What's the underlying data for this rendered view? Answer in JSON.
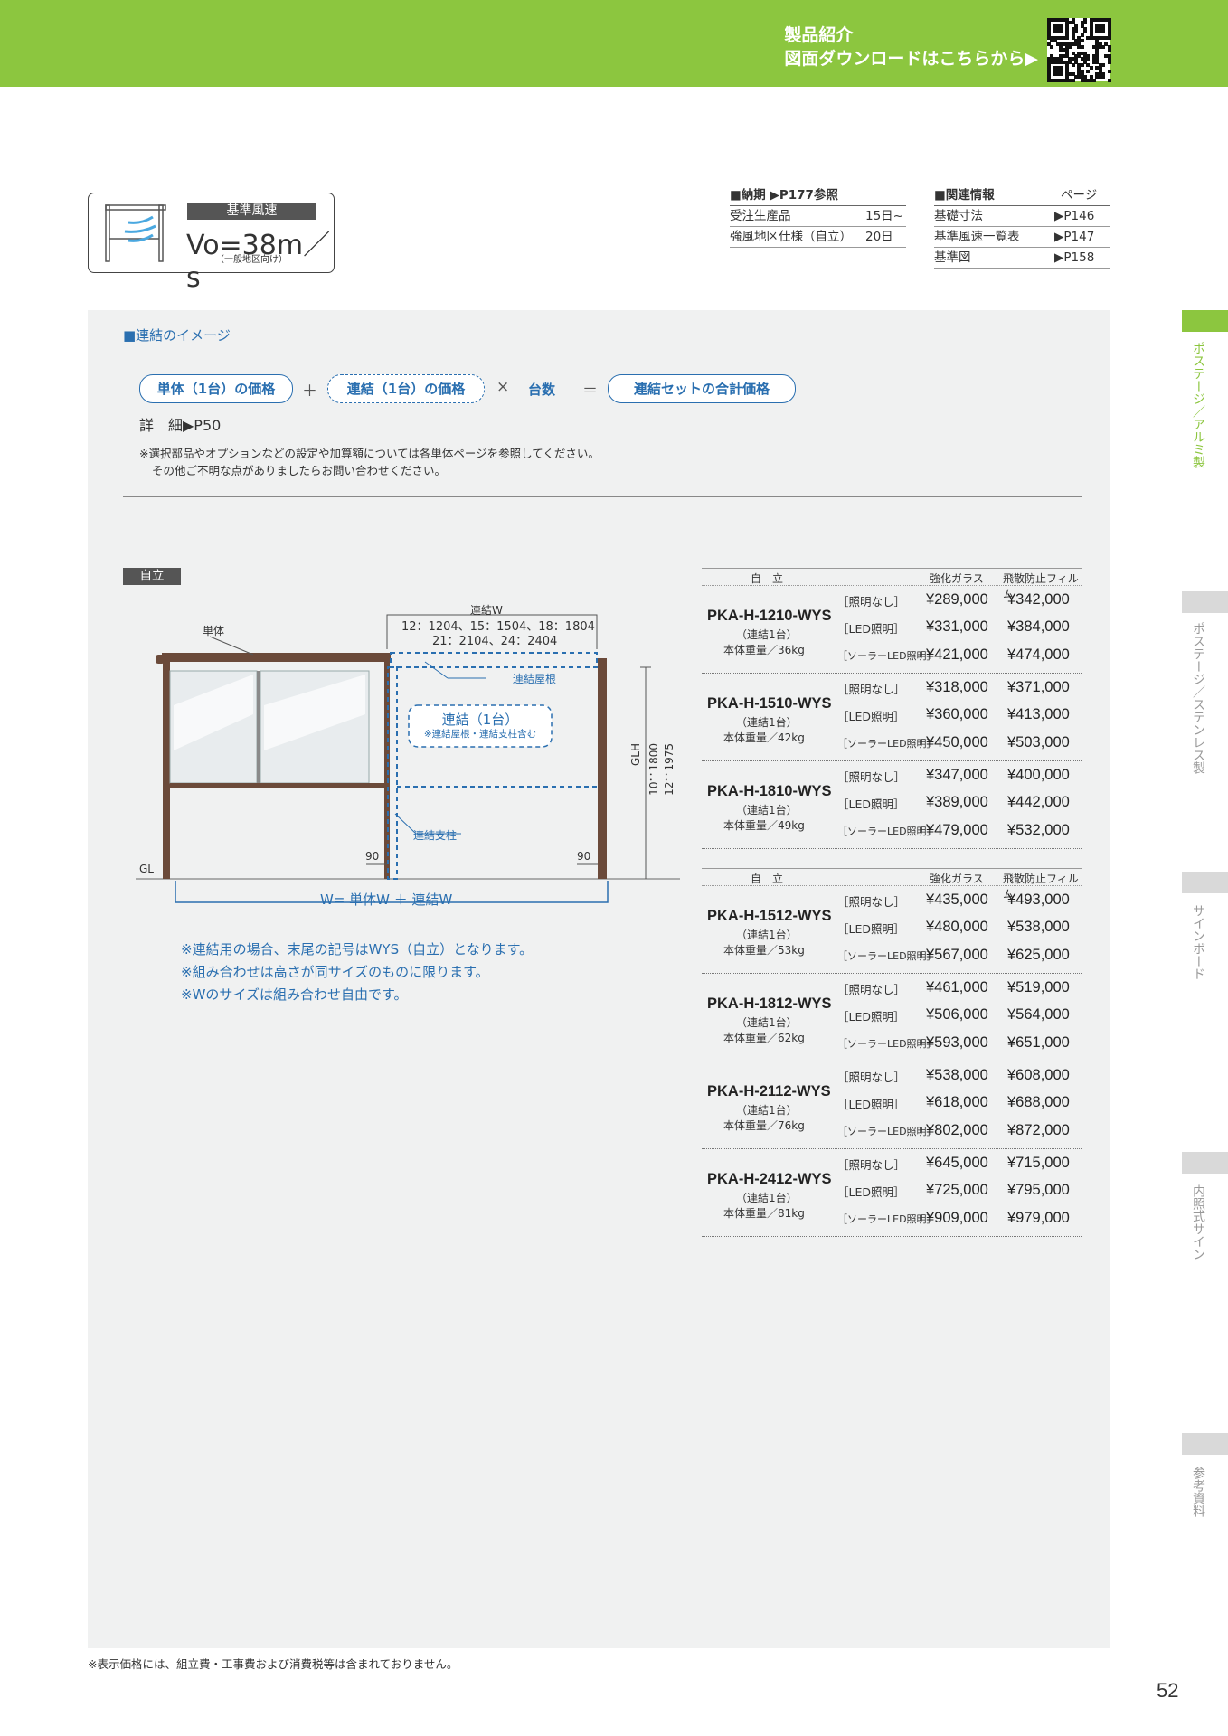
{
  "header": {
    "line1": "製品紹介",
    "line2": "図面ダウンロードはこちらから▶",
    "accent_color": "#8cc63f"
  },
  "wind": {
    "title": "基準風速",
    "value": "Vo=38m／s",
    "note": "（一般地区向け）"
  },
  "delivery": {
    "head": "■納期 ▶P177参照",
    "rows": [
      {
        "label": "受注生産品",
        "value": "15日~"
      },
      {
        "label": "強風地区仕様（自立）",
        "value": "20日"
      }
    ]
  },
  "related": {
    "head": "■関連情報",
    "page_head": "ページ",
    "rows": [
      {
        "label": "基礎寸法",
        "value": "▶P146"
      },
      {
        "label": "基準風速一覧表",
        "value": "▶P147"
      },
      {
        "label": "基準図",
        "value": "▶P158"
      }
    ]
  },
  "image_section": {
    "title": "■連結のイメージ",
    "formula": {
      "single": "単体（1台）の価格",
      "plus": "＋",
      "link": "連結（1台）の価格",
      "times": "×",
      "count": "台数",
      "equals": "＝",
      "total": "連結セットの合計価格"
    },
    "detail": "詳　細▶P50",
    "notes": [
      "※選択部品やオプションなどの設定や加算額については各単体ページを参照してください。",
      "その他ご不明な点がありましたらお問い合わせください。"
    ]
  },
  "diagram": {
    "tag": "自立",
    "w_title": "連結W",
    "w_line1": "12：1204、15：1504、18：1804",
    "w_line2": "21：2104、24：2404",
    "single_label": "単体",
    "roof_label": "連結屋根",
    "link_title": "連結（1台）",
    "link_note": "※連結屋根・連結支柱含む",
    "post_label": "連結支柱",
    "glh": "GLH",
    "glh_10": "10：1800",
    "glh_12": "12：1975",
    "gl": "GL",
    "dim_90_left": "90",
    "dim_90_right": "90",
    "w_formula": "W= 単体W ＋ 連結W",
    "frame_color": "#6b4a3a",
    "dash_color": "#2a6fb0"
  },
  "diagram_notes": [
    "※連結用の場合、末尾の記号はWYS（自立）となります。",
    "※組み合わせは高さが同サイズのものに限ります。",
    "※Wのサイズは組み合わせ自由です。"
  ],
  "price_tables": [
    {
      "head": {
        "type": "自　立",
        "col1": "強化ガラス",
        "col2": "飛散防止フィルム"
      },
      "products": [
        {
          "name": "PKA-H-1210-WYS",
          "sub": "（連結1台）",
          "weight": "本体重量／36kg",
          "rows": [
            {
              "label": "［照明なし］",
              "v1": "¥289,000",
              "v2": "¥342,000"
            },
            {
              "label": "［LED照明］",
              "v1": "¥331,000",
              "v2": "¥384,000"
            },
            {
              "label": "［ソーラーLED照明］",
              "v1": "¥421,000",
              "v2": "¥474,000"
            }
          ]
        },
        {
          "name": "PKA-H-1510-WYS",
          "sub": "（連結1台）",
          "weight": "本体重量／42kg",
          "rows": [
            {
              "label": "［照明なし］",
              "v1": "¥318,000",
              "v2": "¥371,000"
            },
            {
              "label": "［LED照明］",
              "v1": "¥360,000",
              "v2": "¥413,000"
            },
            {
              "label": "［ソーラーLED照明］",
              "v1": "¥450,000",
              "v2": "¥503,000"
            }
          ]
        },
        {
          "name": "PKA-H-1810-WYS",
          "sub": "（連結1台）",
          "weight": "本体重量／49kg",
          "rows": [
            {
              "label": "［照明なし］",
              "v1": "¥347,000",
              "v2": "¥400,000"
            },
            {
              "label": "［LED照明］",
              "v1": "¥389,000",
              "v2": "¥442,000"
            },
            {
              "label": "［ソーラーLED照明］",
              "v1": "¥479,000",
              "v2": "¥532,000"
            }
          ]
        }
      ]
    },
    {
      "head": {
        "type": "自　立",
        "col1": "強化ガラス",
        "col2": "飛散防止フィルム"
      },
      "products": [
        {
          "name": "PKA-H-1512-WYS",
          "sub": "（連結1台）",
          "weight": "本体重量／53kg",
          "rows": [
            {
              "label": "［照明なし］",
              "v1": "¥435,000",
              "v2": "¥493,000"
            },
            {
              "label": "［LED照明］",
              "v1": "¥480,000",
              "v2": "¥538,000"
            },
            {
              "label": "［ソーラーLED照明］",
              "v1": "¥567,000",
              "v2": "¥625,000"
            }
          ]
        },
        {
          "name": "PKA-H-1812-WYS",
          "sub": "（連結1台）",
          "weight": "本体重量／62kg",
          "rows": [
            {
              "label": "［照明なし］",
              "v1": "¥461,000",
              "v2": "¥519,000"
            },
            {
              "label": "［LED照明］",
              "v1": "¥506,000",
              "v2": "¥564,000"
            },
            {
              "label": "［ソーラーLED照明］",
              "v1": "¥593,000",
              "v2": "¥651,000"
            }
          ]
        },
        {
          "name": "PKA-H-2112-WYS",
          "sub": "（連結1台）",
          "weight": "本体重量／76kg",
          "rows": [
            {
              "label": "［照明なし］",
              "v1": "¥538,000",
              "v2": "¥608,000"
            },
            {
              "label": "［LED照明］",
              "v1": "¥618,000",
              "v2": "¥688,000"
            },
            {
              "label": "［ソーラーLED照明］",
              "v1": "¥802,000",
              "v2": "¥872,000"
            }
          ]
        },
        {
          "name": "PKA-H-2412-WYS",
          "sub": "（連結1台）",
          "weight": "本体重量／81kg",
          "rows": [
            {
              "label": "［照明なし］",
              "v1": "¥645,000",
              "v2": "¥715,000"
            },
            {
              "label": "［LED照明］",
              "v1": "¥725,000",
              "v2": "¥795,000"
            },
            {
              "label": "［ソーラーLED照明］",
              "v1": "¥909,000",
              "v2": "¥979,000"
            }
          ]
        }
      ]
    }
  ],
  "side_tabs": [
    {
      "label": "ポステージ／アルミ製",
      "active": true
    },
    {
      "label": "ポステージ／ステンレス製",
      "active": false
    },
    {
      "label": "サインボード",
      "active": false
    },
    {
      "label": "内照式サイン",
      "active": false
    },
    {
      "label": "参考資料",
      "active": false
    }
  ],
  "footer": {
    "note": "※表示価格には、組立費・工事費および消費税等は含まれておりません。",
    "page_number": "52"
  }
}
